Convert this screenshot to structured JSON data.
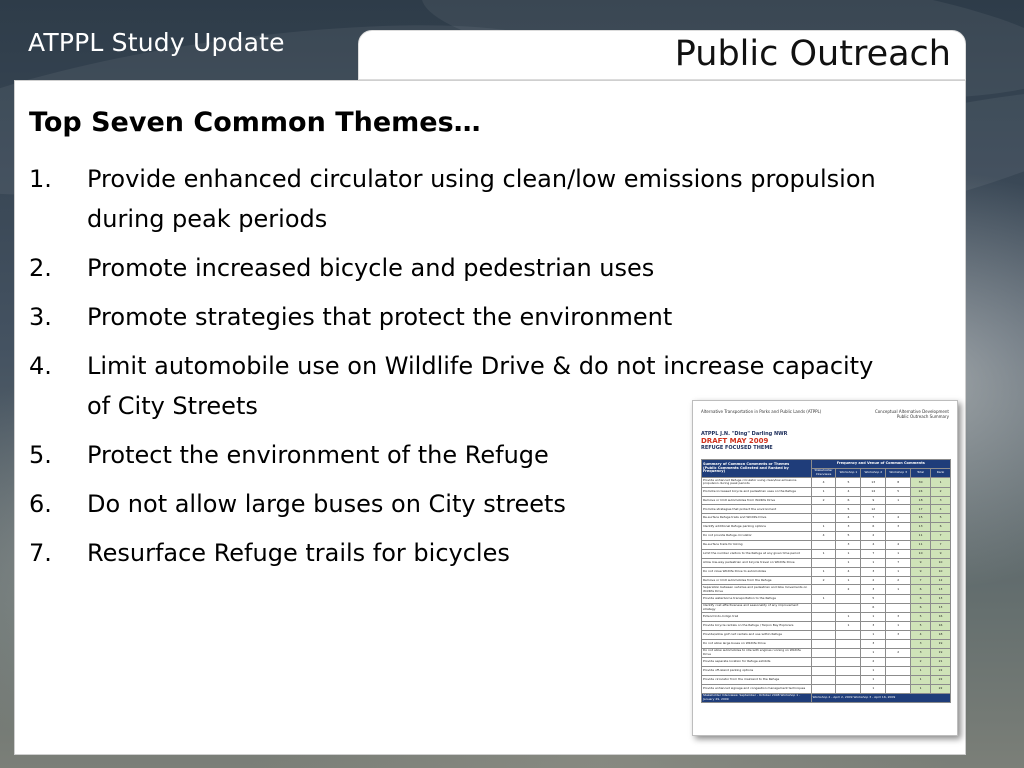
{
  "header": {
    "left_title": "ATPPL Study Update",
    "slide_title": "Public Outreach"
  },
  "content": {
    "heading": "Top Seven Common Themes…",
    "themes": [
      {
        "num": "1.",
        "text": "Provide enhanced circulator using clean/low emissions propulsion during peak periods"
      },
      {
        "num": "2.",
        "text": "Promote increased bicycle and pedestrian uses"
      },
      {
        "num": "3.",
        "text": "Promote strategies that protect the environment"
      },
      {
        "num": "4.",
        "text": "Limit automobile use on Wildlife Drive & do not increase capacity of City Streets"
      },
      {
        "num": "5.",
        "text": "Protect the environment of the Refuge"
      },
      {
        "num": "6.",
        "text": "Do not allow large buses on City streets"
      },
      {
        "num": "7.",
        "text": "Resurface Refuge trails for bicycles"
      }
    ]
  },
  "document_thumbnail": {
    "top_left": "Alternative Transportation in Parks and Public Lands (ATPPL)",
    "top_right_line1": "Conceptual Alternative Development",
    "top_right_line2": "Public Outreach Summary",
    "name": "ATPPL J.N. \"Ding\" Darling NWR",
    "draft": "DRAFT MAY 2009",
    "theme_label": "REFUGE FOCUSED THEME",
    "table_header": "Summary of Common Comments or Themes",
    "table_subheader": "(Public Comments Collected and Ranked by Frequency)",
    "freq_header": "Frequency and Venue of Common Comments",
    "columns": [
      "Stakeholder Interviews",
      "Workshop 1",
      "Workshop 2",
      "Workshop 3",
      "Total",
      "Rank"
    ],
    "rows": [
      [
        "Provide enhanced Refuge circulator using clean/low emissions propulsion during peak periods",
        "4",
        "5",
        "13",
        "8",
        "30",
        "1"
      ],
      [
        "Promote increased bicycle and pedestrian uses on the Refuge",
        "1",
        "4",
        "14",
        "5",
        "24",
        "2"
      ],
      [
        "Remove or limit automobiles from Wildlife Drive",
        "2",
        "6",
        "9",
        "1",
        "18",
        "3"
      ],
      [
        "Promote strategies that protect the environment",
        "",
        "5",
        "12",
        "",
        "17",
        "4"
      ],
      [
        "Re-surface Refuge trails and Wildlife Drive",
        "",
        "4",
        "7",
        "4",
        "15",
        "5"
      ],
      [
        "Identify additional Refuge parking options",
        "1",
        "3",
        "6",
        "3",
        "13",
        "6"
      ],
      [
        "Do not provide Refuge circulator",
        "4",
        "5",
        "2",
        "",
        "11",
        "7"
      ],
      [
        "Re-surface trails for biking",
        "",
        "3",
        "4",
        "4",
        "11",
        "7"
      ],
      [
        "Limit the number visitors to the Refuge at any given time period",
        "1",
        "1",
        "7",
        "1",
        "10",
        "9"
      ],
      [
        "Allow low-way pedestrian and bicycle travel on Wildlife Drive",
        "",
        "1",
        "1",
        "7",
        "9",
        "10"
      ],
      [
        "Do not close Wildlife Drive to automobiles",
        "1",
        "4",
        "3",
        "1",
        "9",
        "10"
      ],
      [
        "Remove or limit automobiles from the Refuge",
        "2",
        "1",
        "2",
        "2",
        "7",
        "12"
      ],
      [
        "Separation between vehicles and pedestrian and bike movements on Wildlife Drive",
        "",
        "2",
        "3",
        "1",
        "6",
        "13"
      ],
      [
        "Provide waterborne transportation to the Refuge",
        "1",
        "",
        "5",
        "",
        "6",
        "13"
      ],
      [
        "Identify cost effectiveness and seasonality of any improvement strategy",
        "",
        "",
        "6",
        "",
        "6",
        "13"
      ],
      [
        "Extend Indo-Indigo trail",
        "",
        "1",
        "1",
        "3",
        "5",
        "16"
      ],
      [
        "Provide bicycle rentals on the Refuge / Tarpon Bay Explorers",
        "",
        "1",
        "3",
        "1",
        "5",
        "16"
      ],
      [
        "Provide/allow golf cart rentals and use within Refuge",
        "",
        "",
        "1",
        "3",
        "4",
        "18"
      ],
      [
        "Do not allow large buses on Wildlife Drive",
        "",
        "",
        "3",
        "",
        "3",
        "19"
      ],
      [
        "Do not allow automobiles to idle with engines running on Wildlife Drive",
        "",
        "",
        "1",
        "2",
        "3",
        "19"
      ],
      [
        "Provide separate location for Refuge exhibits",
        "",
        "",
        "2",
        "",
        "2",
        "21"
      ],
      [
        "Provide off-island parking options",
        "",
        "",
        "1",
        "",
        "1",
        "22"
      ],
      [
        "Provide circulator from the mainland to the Refuge",
        "",
        "",
        "1",
        "",
        "1",
        "22"
      ],
      [
        "Provide enhanced signage and congestion management techniques",
        "",
        "",
        "1",
        "",
        "1",
        "22"
      ]
    ],
    "footer_left": "Stakeholder Interviews: September - October 2008   Workshop 1 - January 29, 2009",
    "footer_right": "Workshop 2 - April 2, 2009   Workshop 3 - April 16, 2009"
  }
}
